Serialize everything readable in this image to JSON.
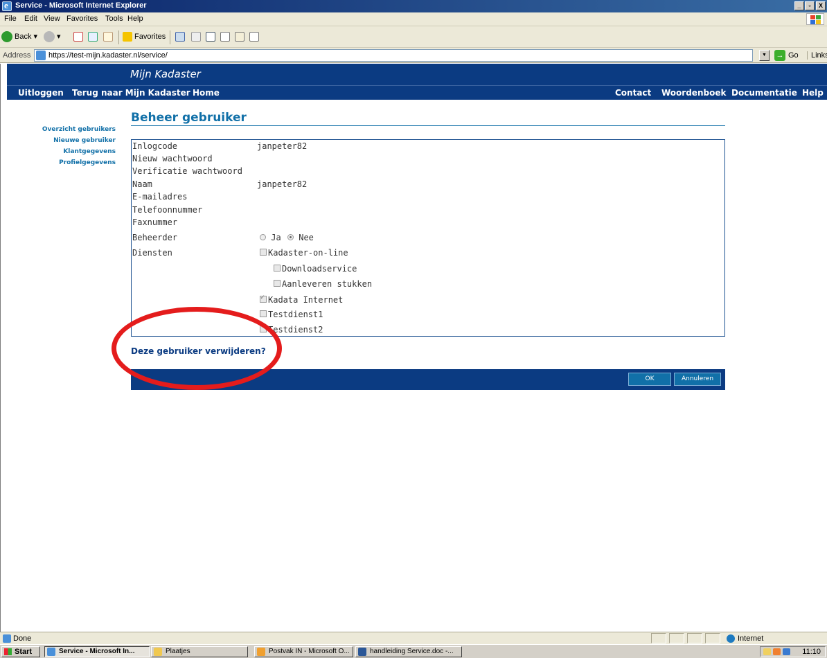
{
  "window": {
    "title": "Service - Microsoft Internet Explorer",
    "controls": [
      "_",
      "▫",
      "X"
    ]
  },
  "menu": [
    "File",
    "Edit",
    "View",
    "Favorites",
    "Tools",
    "Help"
  ],
  "toolbar": {
    "back_label": "Back",
    "favorites_label": "Favorites"
  },
  "address": {
    "label": "Address",
    "url": "https://test-mijn.kadaster.nl/service/",
    "go_label": "Go",
    "links_label": "Links"
  },
  "site": {
    "brand": "Mijn Kadaster",
    "nav_left": [
      "Uitloggen",
      "Terug naar Mijn Kadaster",
      "Home"
    ],
    "nav_right": [
      "Contact",
      "Woordenboek",
      "Documentatie",
      "Help"
    ],
    "sidebar": [
      "Overzicht gebruikers",
      "Nieuwe gebruiker",
      "Klantgegevens",
      "Profielgegevens"
    ]
  },
  "page": {
    "heading": "Beheer gebruiker",
    "fields": {
      "inlogcode": {
        "label": "Inlogcode",
        "value": "janpeter82"
      },
      "nieuw_wachtwoord": {
        "label": "Nieuw wachtwoord"
      },
      "verificatie": {
        "label": "Verificatie wachtwoord"
      },
      "naam": {
        "label": "Naam",
        "value": "janpeter82"
      },
      "email": {
        "label": "E-mailadres"
      },
      "telefoon": {
        "label": "Telefoonnummer"
      },
      "fax": {
        "label": "Faxnummer"
      },
      "beheerder": {
        "label": "Beheerder",
        "option_yes": "Ja",
        "option_no": "Nee",
        "selected": "Nee"
      },
      "diensten": {
        "label": "Diensten"
      }
    },
    "services": [
      {
        "label": "Kadaster-on-line",
        "checked": false
      },
      {
        "label": "Downloadservice",
        "checked": false
      },
      {
        "label": "Aanleveren stukken",
        "checked": false
      },
      {
        "label": "Kadata Internet",
        "checked": true
      },
      {
        "label": "Testdienst1",
        "checked": false
      },
      {
        "label": "Testdienst2",
        "checked": false
      }
    ],
    "delete_link": "Deze gebruiker verwijderen?",
    "ok_label": "OK",
    "cancel_label": "Annuleren"
  },
  "status": {
    "text": "Done",
    "zone": "Internet"
  },
  "taskbar": {
    "start": "Start",
    "tasks": [
      "Service - Microsoft In...",
      "Plaatjes",
      "Postvak IN - Microsoft O...",
      "handleiding Service.doc -..."
    ],
    "clock": "11:10"
  },
  "colors": {
    "site_blue": "#0b3b82",
    "link_teal": "#1170a8",
    "annotation_red": "#e41c1c"
  }
}
